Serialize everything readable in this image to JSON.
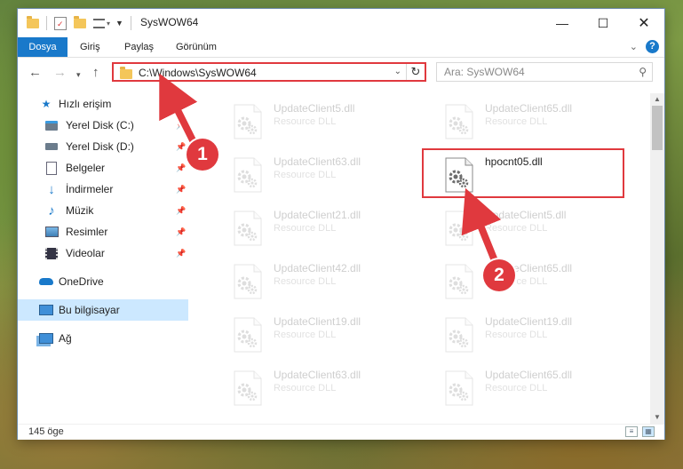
{
  "window": {
    "title": "SysWOW64"
  },
  "ribbon": {
    "tabs": [
      {
        "label": "Dosya",
        "active": true
      },
      {
        "label": "Giriş",
        "active": false
      },
      {
        "label": "Paylaş",
        "active": false
      },
      {
        "label": "Görünüm",
        "active": false
      }
    ]
  },
  "address": {
    "path": "C:\\Windows\\SysWOW64"
  },
  "search": {
    "placeholder": "Ara: SysWOW64"
  },
  "sidebar": {
    "items": [
      {
        "label": "Hızlı erişim",
        "icon": "star-icon",
        "pinned": false
      },
      {
        "label": "Yerel Disk (C:)",
        "icon": "drive-icon",
        "pinned": true
      },
      {
        "label": "Yerel Disk (D:)",
        "icon": "drive-icon",
        "pinned": true
      },
      {
        "label": "Belgeler",
        "icon": "document-icon",
        "pinned": true
      },
      {
        "label": "İndirmeler",
        "icon": "download-icon",
        "pinned": true
      },
      {
        "label": "Müzik",
        "icon": "music-icon",
        "pinned": true
      },
      {
        "label": "Resimler",
        "icon": "picture-icon",
        "pinned": true
      },
      {
        "label": "Videolar",
        "icon": "video-icon",
        "pinned": true
      },
      {
        "label": "OneDrive",
        "icon": "cloud-icon",
        "pinned": false
      },
      {
        "label": "Bu bilgisayar",
        "icon": "computer-icon",
        "pinned": false,
        "selected": true
      },
      {
        "label": "Ağ",
        "icon": "network-icon",
        "pinned": false
      }
    ]
  },
  "files": {
    "column1": [
      {
        "name": "UpdateClient5.dll",
        "type": "Resource DLL"
      },
      {
        "name": "UpdateClient63.dll",
        "type": "Resource DLL"
      },
      {
        "name": "UpdateClient21.dll",
        "type": "Resource DLL"
      },
      {
        "name": "UpdateClient42.dll",
        "type": "Resource DLL"
      },
      {
        "name": "UpdateClient19.dll",
        "type": "Resource DLL"
      },
      {
        "name": "UpdateClient63.dll",
        "type": "Resource DLL"
      }
    ],
    "column2": [
      {
        "name": "UpdateClient65.dll",
        "type": "Resource DLL"
      },
      {
        "name": "hpocnt05.dll",
        "type": ""
      },
      {
        "name": "UpdateClient5.dll",
        "type": "Resource DLL"
      },
      {
        "name": "UpdateClient65.dll",
        "type": "Resource DLL"
      },
      {
        "name": "UpdateClient19.dll",
        "type": "Resource DLL"
      },
      {
        "name": "UpdateClient65.dll",
        "type": "Resource DLL"
      }
    ]
  },
  "status": {
    "count": "145 öge"
  },
  "annotations": {
    "badge1": "1",
    "badge2": "2"
  },
  "colors": {
    "accent": "#1979ca",
    "highlight": "#e0393e",
    "selection": "#cce8ff"
  }
}
